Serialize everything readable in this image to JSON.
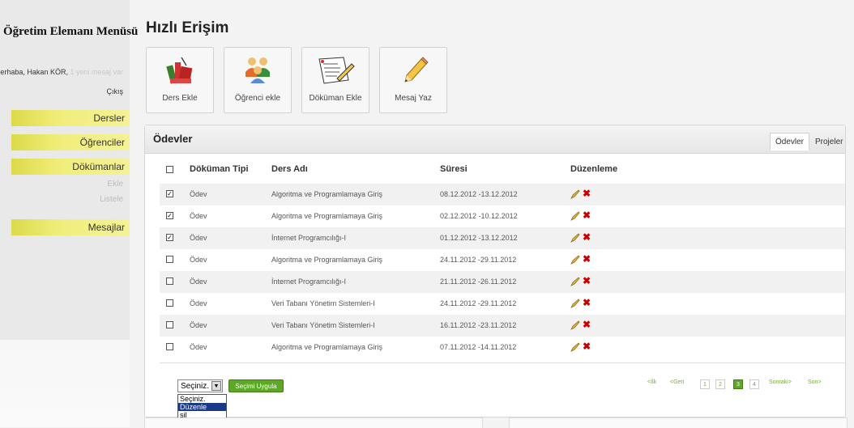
{
  "sidebar": {
    "title": "Öğretim Elemanı Menüsü",
    "greeting": "Merhaba, Hakan KÖR,",
    "messages": "1 yeni mesaj var",
    "logout": "Çıkış",
    "items": [
      {
        "label": "Dersler"
      },
      {
        "label": "Öğrenciler"
      },
      {
        "label": "Dökümanlar"
      },
      {
        "label": "Mesajlar"
      }
    ],
    "sub_items": [
      "Ekle",
      "Listele"
    ]
  },
  "main": {
    "title": "Hızlı Erişim",
    "quick_actions": [
      {
        "label": "Ders Ekle",
        "icon": "books-icon"
      },
      {
        "label": "Öğrenci ekle",
        "icon": "users-icon"
      },
      {
        "label": "Döküman Ekle",
        "icon": "document-icon"
      },
      {
        "label": "Mesaj Yaz",
        "icon": "pencil-icon"
      }
    ]
  },
  "panel": {
    "title": "Ödevler",
    "tabs": [
      "Ödevler",
      "Projeler"
    ],
    "columns": [
      "Döküman Tipi",
      "Ders Adı",
      "Süresi",
      "Düzenleme"
    ],
    "rows": [
      {
        "type": "Ödev",
        "course": "Algoritma ve Programlamaya Giriş",
        "duration": "08.12.2012 -13.12.2012",
        "checked": true
      },
      {
        "type": "Ödev",
        "course": "Algoritma ve Programlamaya Giriş",
        "duration": "02.12.2012 -10.12.2012",
        "checked": true
      },
      {
        "type": "Ödev",
        "course": "İnternet Programcılığı-I",
        "duration": "01.12.2012 -13.12.2012",
        "checked": true
      },
      {
        "type": "Ödev",
        "course": "Algoritma ve Programlamaya Giriş",
        "duration": "24.11.2012 -29.11.2012",
        "checked": false
      },
      {
        "type": "Ödev",
        "course": "İnternet Programcılığı-I",
        "duration": "21.11.2012 -26.11.2012",
        "checked": false
      },
      {
        "type": "Ödev",
        "course": "Veri Tabanı Yönetim Sistemleri-I",
        "duration": "24.11.2012 -29.11.2012",
        "checked": false
      },
      {
        "type": "Ödev",
        "course": "Veri Tabanı Yönetim Sistemleri-I",
        "duration": "16.11.2012 -23.11.2012",
        "checked": false
      },
      {
        "type": "Ödev",
        "course": "Algoritma ve Programlamaya Giriş",
        "duration": "07.11.2012 -14.11.2012",
        "checked": false
      }
    ],
    "select": {
      "value": "Seçiniz.",
      "options": [
        "Seçiniz.",
        "Düzenle",
        "sil"
      ],
      "highlighted": "Düzenle"
    },
    "apply_label": "Seçimi Uygula",
    "pagination": {
      "first": "<İlk",
      "prev": "<Geri",
      "pages": [
        "1",
        "2",
        "3",
        "4"
      ],
      "current": "3",
      "next": "Sonraki>",
      "last": "Son>"
    }
  },
  "colors": {
    "sidebar_button": "#f0ee7a",
    "accent_green": "#5ea828",
    "delete_red": "#cc0000"
  }
}
